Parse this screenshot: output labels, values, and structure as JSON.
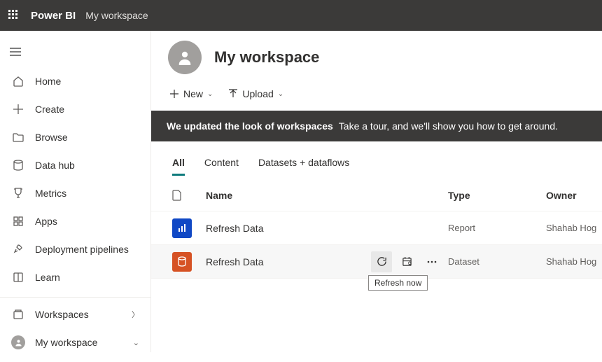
{
  "topbar": {
    "brand": "Power BI",
    "breadcrumb": "My workspace"
  },
  "sidebar": {
    "items": [
      {
        "label": "Home"
      },
      {
        "label": "Create"
      },
      {
        "label": "Browse"
      },
      {
        "label": "Data hub"
      },
      {
        "label": "Metrics"
      },
      {
        "label": "Apps"
      },
      {
        "label": "Deployment pipelines"
      },
      {
        "label": "Learn"
      }
    ],
    "workspaces_label": "Workspaces",
    "current_workspace": "My workspace"
  },
  "header": {
    "title": "My workspace"
  },
  "commands": {
    "new": "New",
    "upload": "Upload"
  },
  "banner": {
    "bold": "We updated the look of workspaces",
    "text": "Take a tour, and we'll show you how to get around."
  },
  "tabs": {
    "all": "All",
    "content": "Content",
    "datasets": "Datasets + dataflows"
  },
  "table": {
    "headers": {
      "name": "Name",
      "type": "Type",
      "owner": "Owner"
    },
    "rows": [
      {
        "name": "Refresh Data",
        "type": "Report",
        "owner": "Shahab Hog"
      },
      {
        "name": "Refresh Data",
        "type": "Dataset",
        "owner": "Shahab Hog"
      }
    ]
  },
  "tooltip": {
    "refresh_now": "Refresh now"
  }
}
